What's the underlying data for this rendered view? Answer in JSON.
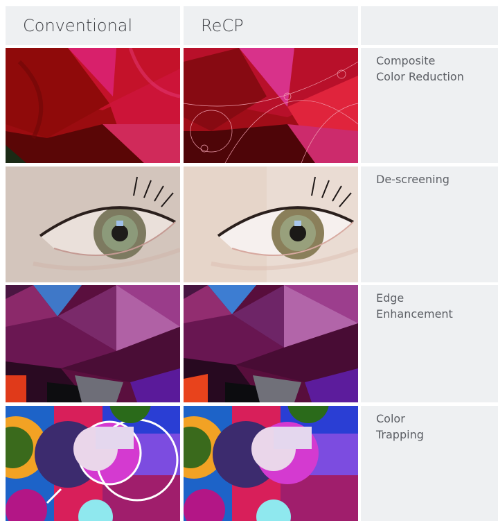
{
  "columns": {
    "conventional": "Conventional",
    "recp": "ReCP",
    "blank": ""
  },
  "rows": [
    {
      "label": "Composite\nColor Reduction"
    },
    {
      "label": "De-screening"
    },
    {
      "label": "Edge\nEnhancement"
    },
    {
      "label": "Color\nTrapping"
    }
  ]
}
